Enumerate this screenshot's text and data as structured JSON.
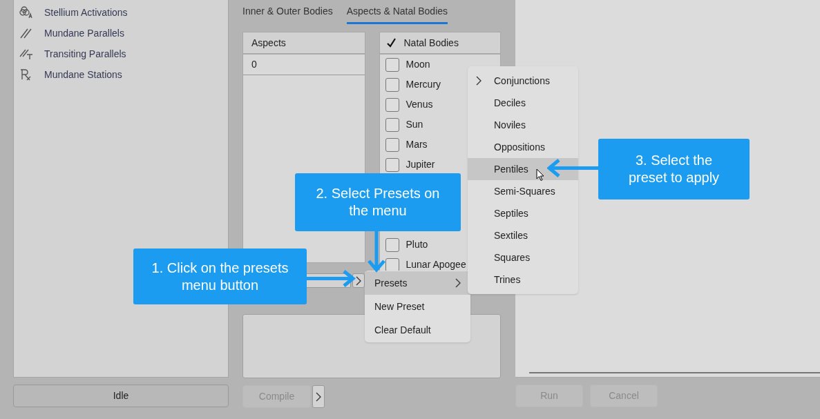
{
  "sidebar": {
    "items": [
      {
        "label": "Stellium Activations",
        "kind": "stellium"
      },
      {
        "label": "Mundane Parallels",
        "kind": "parallels"
      },
      {
        "label": "Transiting Parallels",
        "kind": "transiting"
      },
      {
        "label": "Mundane Stations",
        "kind": "stations"
      }
    ]
  },
  "status_button": "Idle",
  "tabs": [
    {
      "label": "Inner & Outer Bodies",
      "selected": false
    },
    {
      "label": "Aspects & Natal Bodies",
      "selected": true
    }
  ],
  "aspects": {
    "header": "Aspects",
    "rows": [
      "0"
    ]
  },
  "natal_bodies": {
    "header": "Natal Bodies",
    "header_checked": true,
    "upper": [
      {
        "label": "Moon",
        "checked": false
      },
      {
        "label": "Mercury",
        "checked": false
      },
      {
        "label": "Venus",
        "checked": false
      },
      {
        "label": "Sun",
        "checked": false
      },
      {
        "label": "Mars",
        "checked": false
      },
      {
        "label": "Jupiter",
        "checked": false
      }
    ],
    "lower": [
      {
        "label": "Pluto",
        "checked": false
      },
      {
        "label": "Lunar Apogee",
        "checked": false
      }
    ]
  },
  "compile_button": {
    "label": "Compile",
    "disabled": true
  },
  "run_button": {
    "label": "Run",
    "disabled": true
  },
  "cancel_button": {
    "label": "Cancel",
    "disabled": true
  },
  "preset_menu": [
    {
      "label": "Presets",
      "submenu": true,
      "selected": true
    },
    {
      "label": "New Preset",
      "submenu": false,
      "selected": false
    },
    {
      "label": "Clear Default",
      "submenu": false,
      "selected": false
    }
  ],
  "preset_submenu": [
    {
      "label": "Conjunctions",
      "submenu": true,
      "selected": false
    },
    {
      "label": "Deciles",
      "submenu": false,
      "selected": false
    },
    {
      "label": "Noviles",
      "submenu": false,
      "selected": false
    },
    {
      "label": "Oppositions",
      "submenu": false,
      "selected": false
    },
    {
      "label": "Pentiles",
      "submenu": false,
      "selected": true
    },
    {
      "label": "Semi-Squares",
      "submenu": false,
      "selected": false
    },
    {
      "label": "Septiles",
      "submenu": false,
      "selected": false
    },
    {
      "label": "Sextiles",
      "submenu": false,
      "selected": false
    },
    {
      "label": "Squares",
      "submenu": false,
      "selected": false
    },
    {
      "label": "Trines",
      "submenu": false,
      "selected": false
    }
  ],
  "callouts": [
    "1. Click on the presets menu button",
    "2. Select Presets on the menu",
    "3. Select the preset to apply"
  ]
}
